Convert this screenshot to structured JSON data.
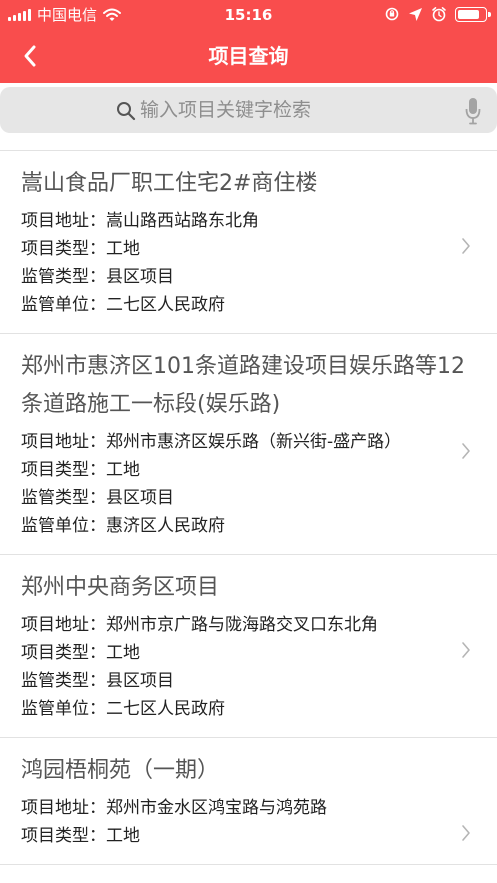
{
  "status_bar": {
    "carrier": "中国电信",
    "time": "15:16",
    "battery_level": 0.82
  },
  "nav": {
    "title": "项目查询",
    "back_icon": "chevron-left-icon"
  },
  "search": {
    "placeholder": "输入项目关键字检索",
    "search_icon": "search-icon",
    "mic_icon": "microphone-icon"
  },
  "field_labels": {
    "address": "项目地址：",
    "type": "项目类型：",
    "supervision": "监管类型：",
    "unit": "监管单位："
  },
  "projects": [
    {
      "name": "嵩山食品厂职工住宅2#商住楼",
      "address": "嵩山路西站路东北角",
      "type": "工地",
      "supervision": "县区项目",
      "unit": "二七区人民政府"
    },
    {
      "name": "郑州市惠济区101条道路建设项目娱乐路等12条道路施工一标段(娱乐路)",
      "address": "郑州市惠济区娱乐路（新兴街-盛产路）",
      "type": "工地",
      "supervision": "县区项目",
      "unit": "惠济区人民政府"
    },
    {
      "name": "郑州中央商务区项目",
      "address": "郑州市京广路与陇海路交叉口东北角",
      "type": "工地",
      "supervision": "县区项目",
      "unit": "二七区人民政府"
    },
    {
      "name": "鸿园梧桐苑（一期）",
      "address": "郑州市金水区鸿宝路与鸿苑路",
      "type": "工地",
      "supervision": "",
      "unit": ""
    }
  ]
}
